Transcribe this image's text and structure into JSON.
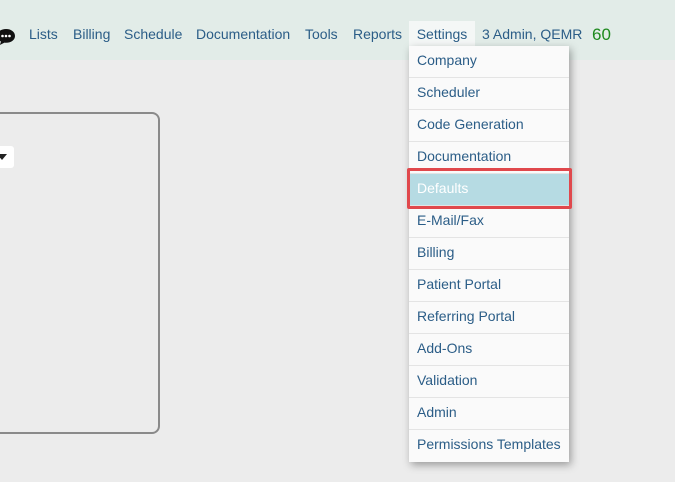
{
  "topbar": {
    "chat_icon": "chat-bubble-icon",
    "nav_items": [
      "Lists",
      "Billing",
      "Schedule",
      "Documentation",
      "Tools",
      "Reports",
      "Settings"
    ],
    "user": "3 Admin, QEMR",
    "count": "60"
  },
  "panel": {
    "dropdown_icon": "caret-down-icon"
  },
  "settings_menu": {
    "items": [
      "Company",
      "Scheduler",
      "Code Generation",
      "Documentation",
      "Defaults",
      "E-Mail/Fax",
      "Billing",
      "Patient Portal",
      "Referring Portal",
      "Add-Ons",
      "Validation",
      "Admin",
      "Permissions Templates"
    ],
    "highlighted": "Defaults"
  },
  "colors": {
    "link": "#2b5d87",
    "count": "#1e8a1e",
    "highlight_bg": "#b6dbe3",
    "annotation_box": "#e0484c"
  }
}
